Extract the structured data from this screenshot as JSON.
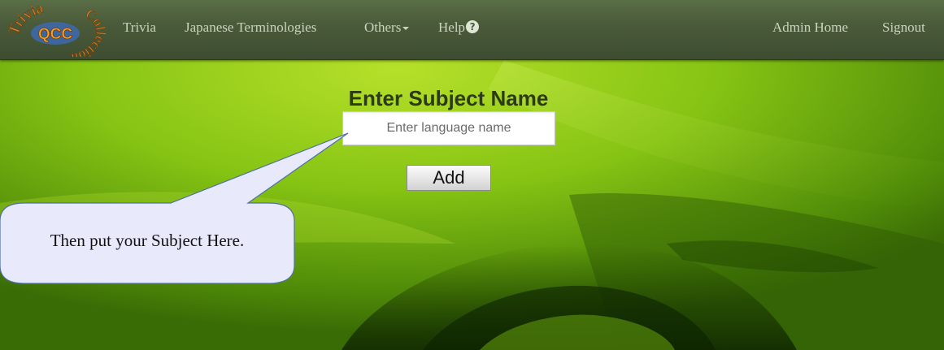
{
  "navbar": {
    "logo_text": {
      "arc_top": "Trivia",
      "center": "QCC",
      "arc_side": "Collection"
    },
    "links": [
      {
        "label": "Trivia"
      },
      {
        "label": "Japanese Terminologies"
      },
      {
        "label": "Others"
      },
      {
        "label": "Help"
      }
    ],
    "right_links": [
      {
        "label": "Admin Home"
      },
      {
        "label": "Signout"
      }
    ]
  },
  "form": {
    "title": "Enter Subject Name",
    "input_placeholder": "Enter language name",
    "input_value": "",
    "add_button": "Add"
  },
  "callout": {
    "text": "Then put your Subject Here."
  },
  "colors": {
    "background_green": "#6aa80a",
    "navbar": "#4a5b3a",
    "callout_fill": "#e8eafc",
    "callout_border": "#4f6fa8"
  }
}
